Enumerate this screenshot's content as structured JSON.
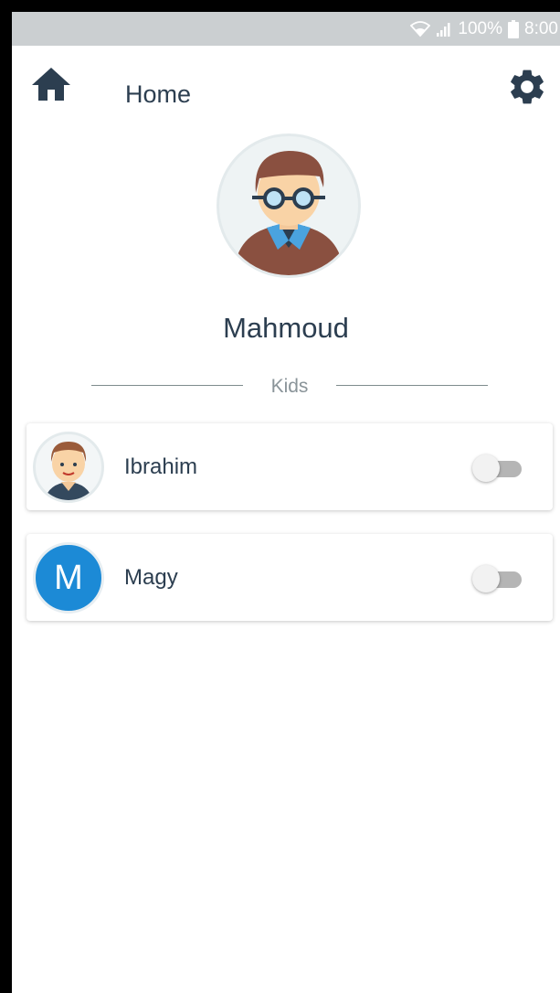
{
  "status_bar": {
    "battery": "100%",
    "time": "8:00",
    "icons": [
      "wifi-icon",
      "signal-icon",
      "battery-icon"
    ]
  },
  "header": {
    "title": "Home",
    "icons": [
      "home-icon",
      "gear-icon"
    ]
  },
  "profile": {
    "name": "Mahmoud"
  },
  "kids_section": {
    "label": "Kids",
    "items": [
      {
        "name": "Ibrahim",
        "avatar": "boy-avatar-image",
        "toggle_on": false
      },
      {
        "name": "Magy",
        "avatar_letter": "M",
        "avatar_color": "#1c8ad6",
        "toggle_on": false
      }
    ]
  },
  "colors": {
    "status_bar": "#cbcfd1",
    "text_primary": "#2c3e50",
    "accent_blue": "#1c8ad6"
  }
}
